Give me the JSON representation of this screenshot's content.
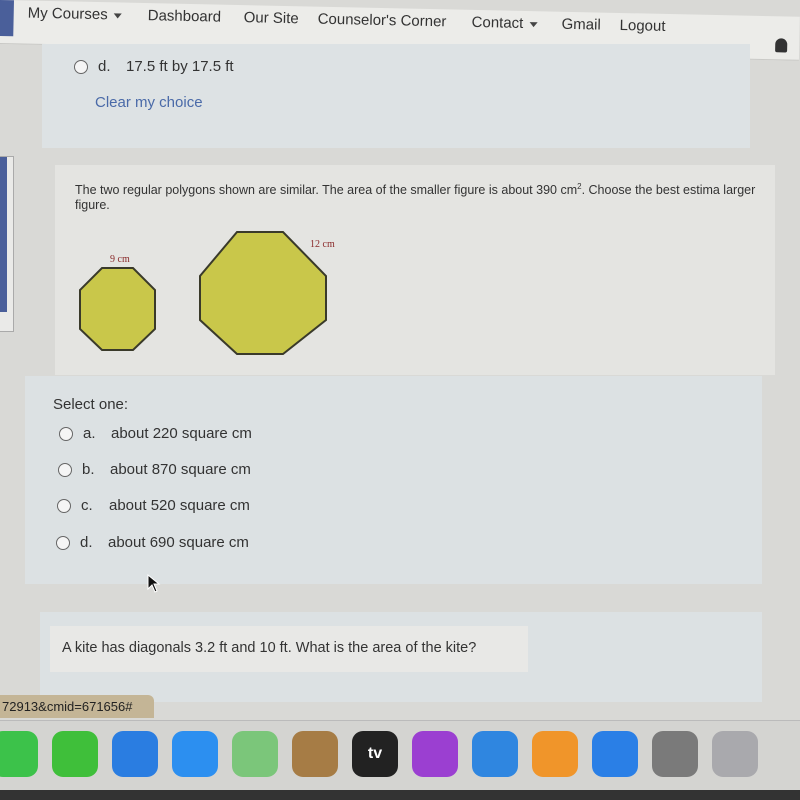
{
  "nav": {
    "items": [
      "My Courses",
      "Dashboard",
      "Our Site",
      "Counselor's Corner",
      "Contact",
      "Gmail",
      "Logout"
    ]
  },
  "prev_question": {
    "option_d_letter": "d.",
    "option_d_text": "17.5 ft by 17.5 ft",
    "clear_choice": "Clear my choice"
  },
  "question": {
    "text_before": "The two regular polygons shown are similar. The area of the smaller figure is about 390 cm",
    "sup": "2",
    "text_after": ". Choose the best estima larger figure.",
    "small_label": "9 cm",
    "large_label": "12 cm",
    "fill_color": "#c9c74a",
    "select_label": "Select one:",
    "options": [
      {
        "letter": "a.",
        "text": "about 220 square cm"
      },
      {
        "letter": "b.",
        "text": "about 870 square cm"
      },
      {
        "letter": "c.",
        "text": "about 520 square cm"
      },
      {
        "letter": "d.",
        "text": "about 690 square cm"
      }
    ]
  },
  "next_question": {
    "text": "A kite has diagonals 3.2 ft and 10 ft. What is the area of the kite?"
  },
  "status_url": "72913&cmid=671656#",
  "dock": {
    "apps": [
      {
        "icon": "facetime-icon",
        "color": "#3cc24a"
      },
      {
        "icon": "numbers-icon",
        "color": "#3fbf3a"
      },
      {
        "icon": "safari-icon",
        "color": "#2a7de1"
      },
      {
        "icon": "mail-icon",
        "color": "#2c8ff0"
      },
      {
        "icon": "maps-icon",
        "color": "#7bc67a"
      },
      {
        "icon": "contacts-icon",
        "color": "#a67c45"
      },
      {
        "icon": "apple-tv-icon",
        "color": "#222222",
        "label": "tv"
      },
      {
        "icon": "podcasts-icon",
        "color": "#9b3fd1"
      },
      {
        "icon": "keynote-icon",
        "color": "#2f86e0"
      },
      {
        "icon": "pages-icon",
        "color": "#f0952a"
      },
      {
        "icon": "app-store-icon",
        "color": "#2a7fe6"
      },
      {
        "icon": "system-preferences-icon",
        "color": "#7a7a7a"
      },
      {
        "icon": "roblox-icon",
        "color": "#a9a9ad"
      }
    ]
  }
}
